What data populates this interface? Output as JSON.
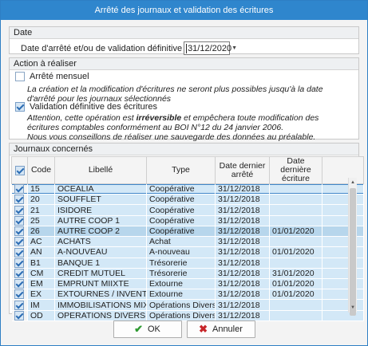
{
  "window": {
    "title": "Arrêté des journaux et validation des écritures"
  },
  "date_section": {
    "header": "Date",
    "label": "Date d'arrêté et/ou de validation définitive",
    "value": "31/12/2020"
  },
  "action_section": {
    "header": "Action à réaliser",
    "option1": {
      "label": "Arrêté mensuel",
      "checked": false,
      "description": "La création et la modification d'écritures ne seront plus possibles jusqu'à la date d'arrêté pour les journaux sélectionnés"
    },
    "option2": {
      "label": "Validation définitive des écritures",
      "checked": true,
      "desc_a": "Attention, cette opération est ",
      "desc_b": "irréversible",
      "desc_c": " et empêchera toute modification des écritures comptables conformément au BOI N°12 du 24 janvier 2006.",
      "desc_d": "Nous vous conseillons de réaliser une sauvegarde des données au préalable."
    }
  },
  "journaux": {
    "header": "Journaux concernés",
    "columns": [
      "Code",
      "Libellé",
      "Type",
      "Date dernier arrêté",
      "Date dernière écriture"
    ],
    "rows": [
      [
        "15",
        "OCEALIA",
        "Coopérative",
        "31/12/2018",
        ""
      ],
      [
        "20",
        "SOUFFLET",
        "Coopérative",
        "31/12/2018",
        ""
      ],
      [
        "21",
        "ISIDORE",
        "Coopérative",
        "31/12/2018",
        ""
      ],
      [
        "25",
        "AUTRE COOP 1",
        "Coopérative",
        "31/12/2018",
        ""
      ],
      [
        "26",
        "AUTRE COOP 2",
        "Coopérative",
        "31/12/2018",
        "01/01/2020"
      ],
      [
        "AC",
        "ACHATS",
        "Achat",
        "31/12/2018",
        ""
      ],
      [
        "AN",
        "A-NOUVEAU",
        "A-nouveau",
        "31/12/2018",
        "01/01/2020"
      ],
      [
        "B1",
        "BANQUE 1",
        "Trésorerie",
        "31/12/2018",
        ""
      ],
      [
        "CM",
        "CREDIT MUTUEL",
        "Trésorerie",
        "31/12/2018",
        "31/01/2020"
      ],
      [
        "EM",
        "EMPRUNT MIIXTE",
        "Extourne",
        "31/12/2018",
        "01/01/2020"
      ],
      [
        "EX",
        "EXTOURNES / INVENTAIRE",
        "Extourne",
        "31/12/2018",
        "01/01/2020"
      ],
      [
        "IM",
        "IMMOBILISATIONS MIXTE",
        "Opérations Diverses",
        "31/12/2018",
        ""
      ],
      [
        "OD",
        "OPERATIONS DIVERSES",
        "Opérations Diverses",
        "31/12/2018",
        ""
      ]
    ]
  },
  "buttons": {
    "ok": "OK",
    "cancel": "Annuler"
  },
  "colors": {
    "titlebar": "#2f86cd",
    "row": "#d3e8f7",
    "selected_row": "#b7d6ec",
    "ok": "#2f9a32",
    "cancel": "#c7262a"
  },
  "icons": {
    "ok": "check-icon",
    "cancel": "x-icon",
    "dropdown": "chevron-down-icon"
  }
}
